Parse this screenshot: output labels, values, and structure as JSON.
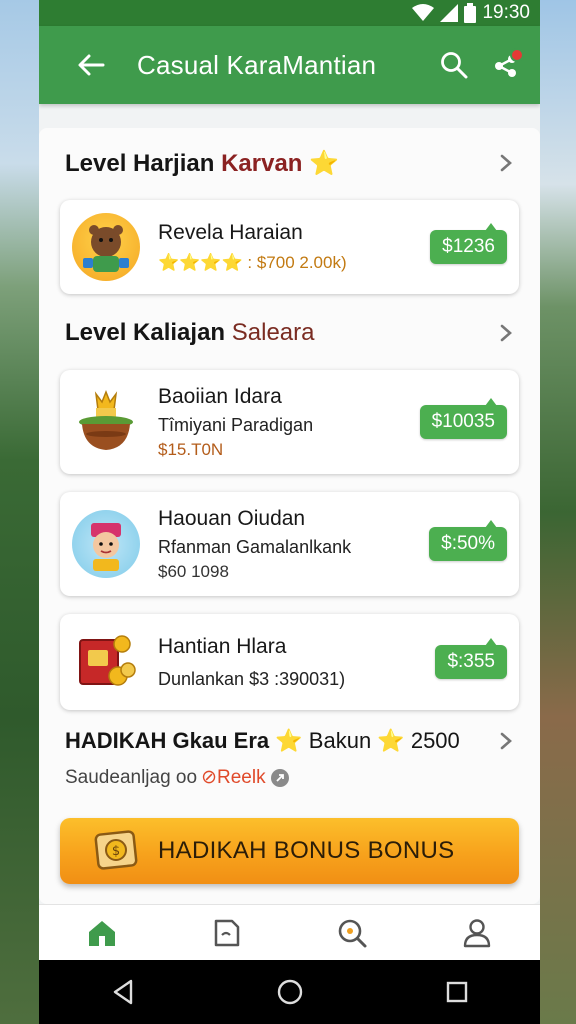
{
  "status_bar": {
    "time": "19:30"
  },
  "app_bar": {
    "title": "Casual KaraMantian"
  },
  "section_daily": {
    "title_prefix": "Level Harjian ",
    "title_accent": "Karvan",
    "star": "⭐"
  },
  "card_daily": {
    "title": "Revela Haraian",
    "rating": "⭐⭐⭐⭐ : $700 2.00k)",
    "price": "$1236"
  },
  "section_kaliajan": {
    "title_prefix": "Level Kaliajan ",
    "title_accent": "Saleara"
  },
  "cards": [
    {
      "title": "Baoiian Idara",
      "subtitle": "Tîmiyani Paradigan",
      "amount": "$15.T0N",
      "price": "$10035"
    },
    {
      "title": "Haouan Oiudan",
      "subtitle": "Rfanman Gamalanlkank",
      "amount": "$60 1098",
      "price": "$:50%"
    },
    {
      "title": "Hantian Hlara",
      "subtitle": "Dunlankan $3 :390031)",
      "amount": "",
      "price": "$:355"
    }
  ],
  "bonus_line": {
    "title_bold": "HADIKAH Gkau Era",
    "star": "⭐",
    "title_rest": " Bakun",
    "star2": "⭐",
    "count": " 2500",
    "subtitle": "Saudeanljag oo ",
    "link": "⊘Reelk"
  },
  "cta": {
    "label": "HADIKAH BONUS  BONUS"
  },
  "bottom_nav": [
    "home-icon",
    "document-icon",
    "search-icon",
    "profile-icon"
  ],
  "colors": {
    "primary": "#3f9b4c",
    "status": "#2e7d32",
    "price": "#4caf50",
    "cta": "#f7a21c",
    "accent": "#8b2222"
  }
}
